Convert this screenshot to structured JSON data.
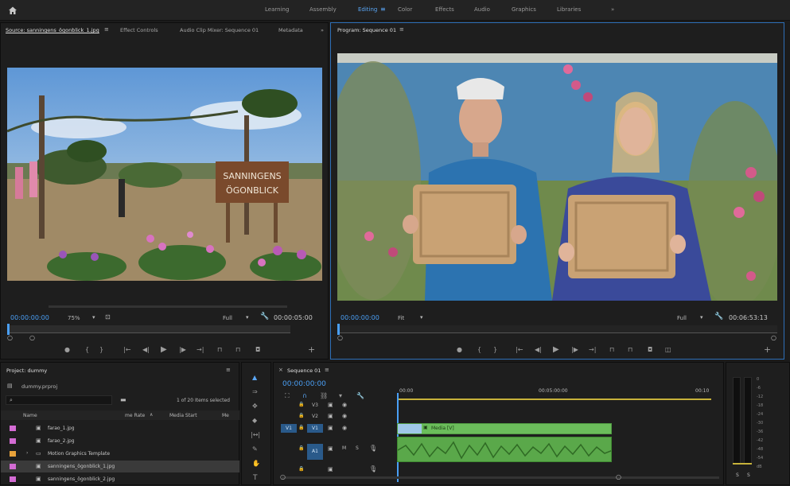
{
  "workspaces": {
    "items": [
      "Learning",
      "Assembly",
      "Editing",
      "Color",
      "Effects",
      "Audio",
      "Graphics",
      "Libraries"
    ],
    "active": "Editing",
    "overflow": "»"
  },
  "source": {
    "tabs": [
      "Source: sanningens_ögonblick_1.jpg",
      "Effect Controls",
      "Audio Clip Mixer: Sequence 01",
      "Metadata"
    ],
    "overflow": "»",
    "timecode": "00:00:00:00",
    "zoom": "75%",
    "quality": "Full",
    "duration": "00:00:05:00",
    "image_text_line1": "SANNINGENS",
    "image_text_line2": "ÖGONBLICK"
  },
  "program": {
    "tab": "Program: Sequence 01",
    "timecode": "00:00:00:00",
    "zoom": "Fit",
    "quality": "Full",
    "duration": "00:06:53:13"
  },
  "project": {
    "title": "Project: dummy",
    "file": "dummy.prproj",
    "item_count": "1 of 20 Items selected",
    "columns": [
      "Name",
      "me Rate",
      "Media Start",
      "Me"
    ],
    "items": [
      {
        "name": "farao_1.jpg",
        "color": "#d36bd3",
        "type": "file"
      },
      {
        "name": "farao_2.jpg",
        "color": "#d36bd3",
        "type": "file"
      },
      {
        "name": "Motion Graphics Template",
        "color": "#e8a23a",
        "type": "folder"
      },
      {
        "name": "sanningens_ögonblick_1.jpg",
        "color": "#d36bd3",
        "type": "file"
      },
      {
        "name": "sanningens_ögonblick_2.jpg",
        "color": "#d36bd3",
        "type": "file"
      }
    ]
  },
  "timeline": {
    "title": "Sequence 01",
    "timecode": "00:00:00:00",
    "ruler": [
      "00:00",
      "00:05:00:00",
      "00:10"
    ],
    "tracks": {
      "v3": "V3",
      "v2": "V2",
      "v1": "V1",
      "a1": "A1",
      "v1_src": "V1",
      "a1_src": "A1",
      "m": "M",
      "s": "S"
    },
    "video_clip": "Media [V]"
  },
  "meter": {
    "scale": [
      "0",
      "-6",
      "-12",
      "-18",
      "-24",
      "-30",
      "-36",
      "-42",
      "-48",
      "-54",
      "dB"
    ],
    "buttons": [
      "S",
      "S"
    ]
  },
  "colors": {
    "accent": "#4a9ff5",
    "clip_green": "#6bbd5b",
    "label_violet": "#d36bd3"
  }
}
